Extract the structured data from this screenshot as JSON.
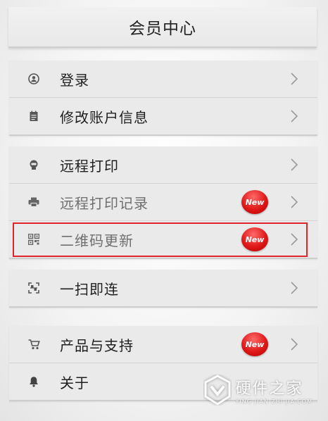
{
  "header": {
    "title": "会员中心"
  },
  "groups": [
    {
      "items": [
        {
          "label": "登录",
          "icon": "user-icon"
        },
        {
          "label": "修改账户信息",
          "icon": "notepad-icon"
        }
      ]
    },
    {
      "items": [
        {
          "label": "远程打印",
          "icon": "remote-print-icon"
        },
        {
          "label": "远程打印记录",
          "icon": "printer-icon",
          "badge": "New"
        },
        {
          "label": "二维码更新",
          "icon": "qr-code-icon",
          "badge": "New"
        }
      ]
    },
    {
      "items": [
        {
          "label": "一扫即连",
          "icon": "scan-icon"
        }
      ]
    },
    {
      "items": [
        {
          "label": "产品与支持",
          "icon": "cart-icon",
          "badge": "New"
        },
        {
          "label": "关于",
          "icon": "bell-icon"
        }
      ]
    }
  ],
  "watermark": {
    "main": "硬件之家",
    "sub": "YING JIAN ZHI JIA.COM"
  },
  "colors": {
    "badge": "#e01818",
    "highlight": "#e0242c"
  }
}
